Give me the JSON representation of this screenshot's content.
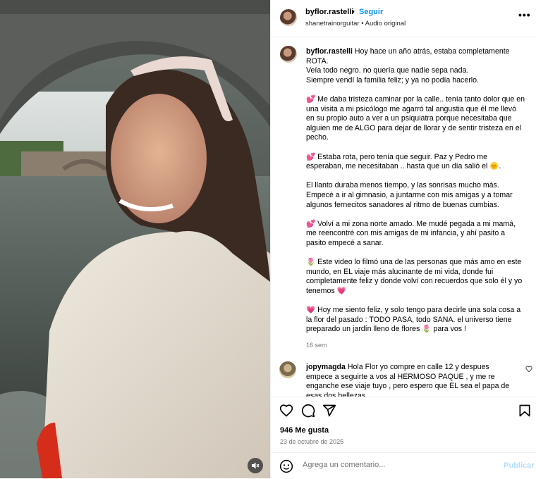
{
  "post": {
    "username": "byflor.rastelli",
    "follow_label": "Seguir",
    "separator": "•",
    "audio_line": "shanetrainorguitar • Audio original",
    "more_label": "•••"
  },
  "caption": {
    "username": "byflor.rastelli",
    "paragraphs": [
      "Hoy hace un año atrás, estaba completamente ROTA.\nVeía todo negro. no quería que nadie sepa nada.\nSiempre vendí la familia feliz; y ya no podía hacerlo.",
      "💕 Me daba tristeza caminar por la calle.. tenía tanto dolor que en una visita a mi psicólogo me agarró tal angustia que él me llevó en su propio auto a ver a un psiquiatra porque necesitaba que alguien me de ALGO para dejar de llorar y de sentir tristeza en el pecho.",
      "💕 Estaba rota, pero tenía que seguir. Paz y Pedro me esperaban, me necesitaban .. hasta que un día salió el 🌞.",
      "El llanto duraba menos tiempo, y las sonrisas mucho más. Empecé a ir al gimnasio, a juntarme con mis amigas y a tomar algunos fernecitos sanadores al ritmo de buenas cumbias.",
      "💕 Volví a mi zona norte amado. Me mudé pegada a mi mamá, me reencontré con mis amigas de mi infancia, y ahí pasito a pasito empecé a sanar.",
      "🌷 Este video lo filmó una de las personas que más amo en este mundo, en EL viaje más alucinante de mi vida, donde fui completamente feliz y donde volví con recuerdos que solo él y yo tenemos 💗",
      "💗 Hoy me siento feliz, y solo tengo para decirle una sola cosa a la flor del pasado : TODO PASA, todo SANA. el universo tiene preparado un jardín lleno de flores 🌷 para vos !"
    ],
    "time": "16 sem"
  },
  "comment": {
    "username": "jopymagda",
    "text": "Hola Flor yo compre en calle 12 y despues empece a seguirte a vos al HERMOSO PAQUE , y me re enganche ese viaje tuyo , pero espero que EL sea el papa de esas dos bellezas"
  },
  "stats": {
    "likes": "946 Me gusta",
    "date": "23 de octubre de 2025"
  },
  "add_comment": {
    "placeholder": "Agrega un comentario...",
    "publish_label": "Publicar"
  },
  "colors": {
    "accent": "#0095f6",
    "publish_disabled": "#b3dbff",
    "muted_text": "#737373",
    "border": "#efefef"
  },
  "icons": [
    "mute-icon",
    "more-icon",
    "like-icon",
    "comment-icon",
    "share-icon",
    "save-icon",
    "emoji-icon",
    "small-heart-icon"
  ]
}
